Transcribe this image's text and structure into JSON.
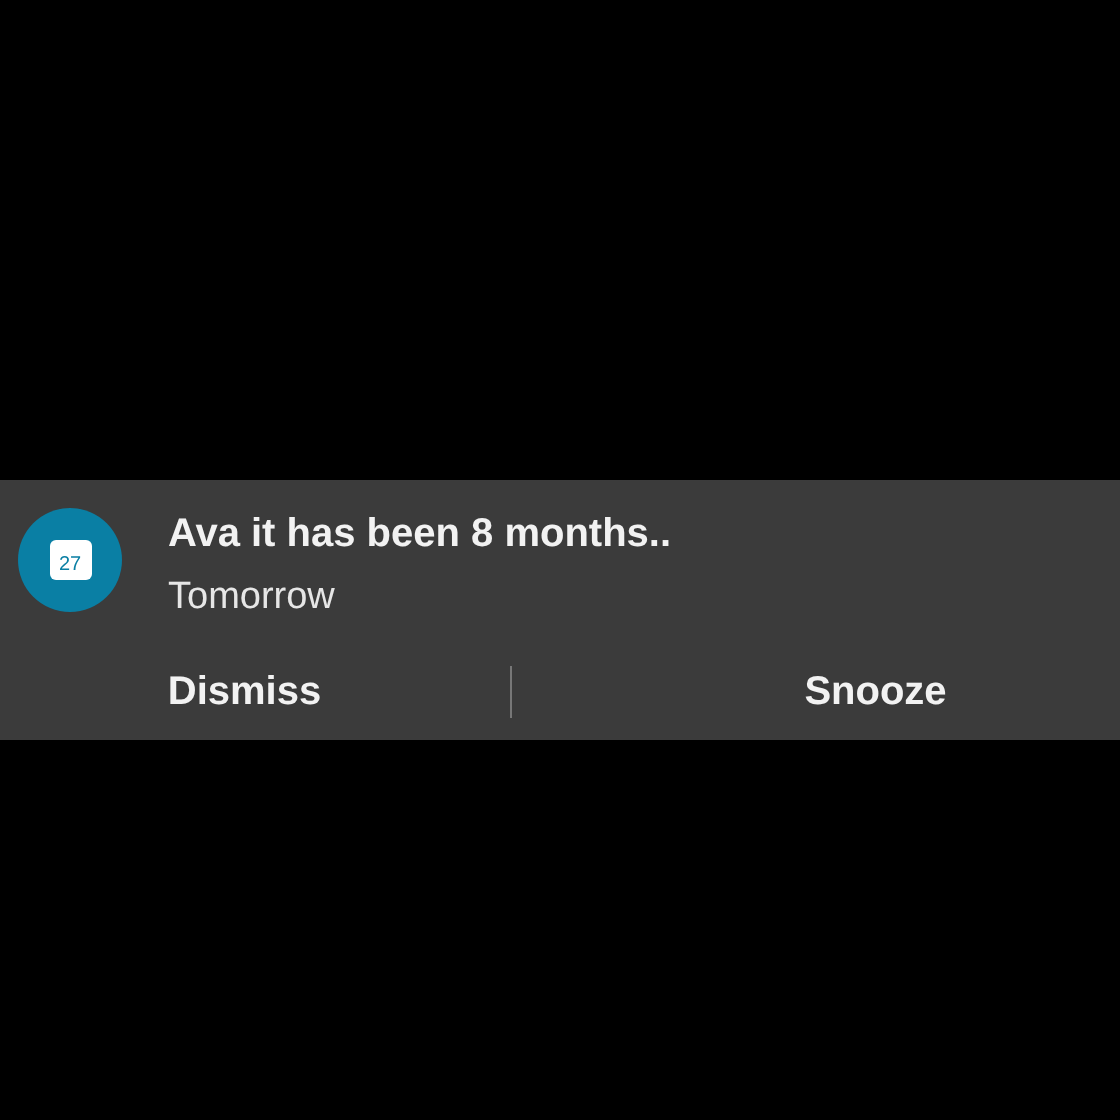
{
  "notification": {
    "app_icon_day": "27",
    "title": "Ava it has been 8 months..",
    "subtitle": "Tomorrow",
    "actions": [
      "Dismiss",
      "Snooze"
    ]
  }
}
